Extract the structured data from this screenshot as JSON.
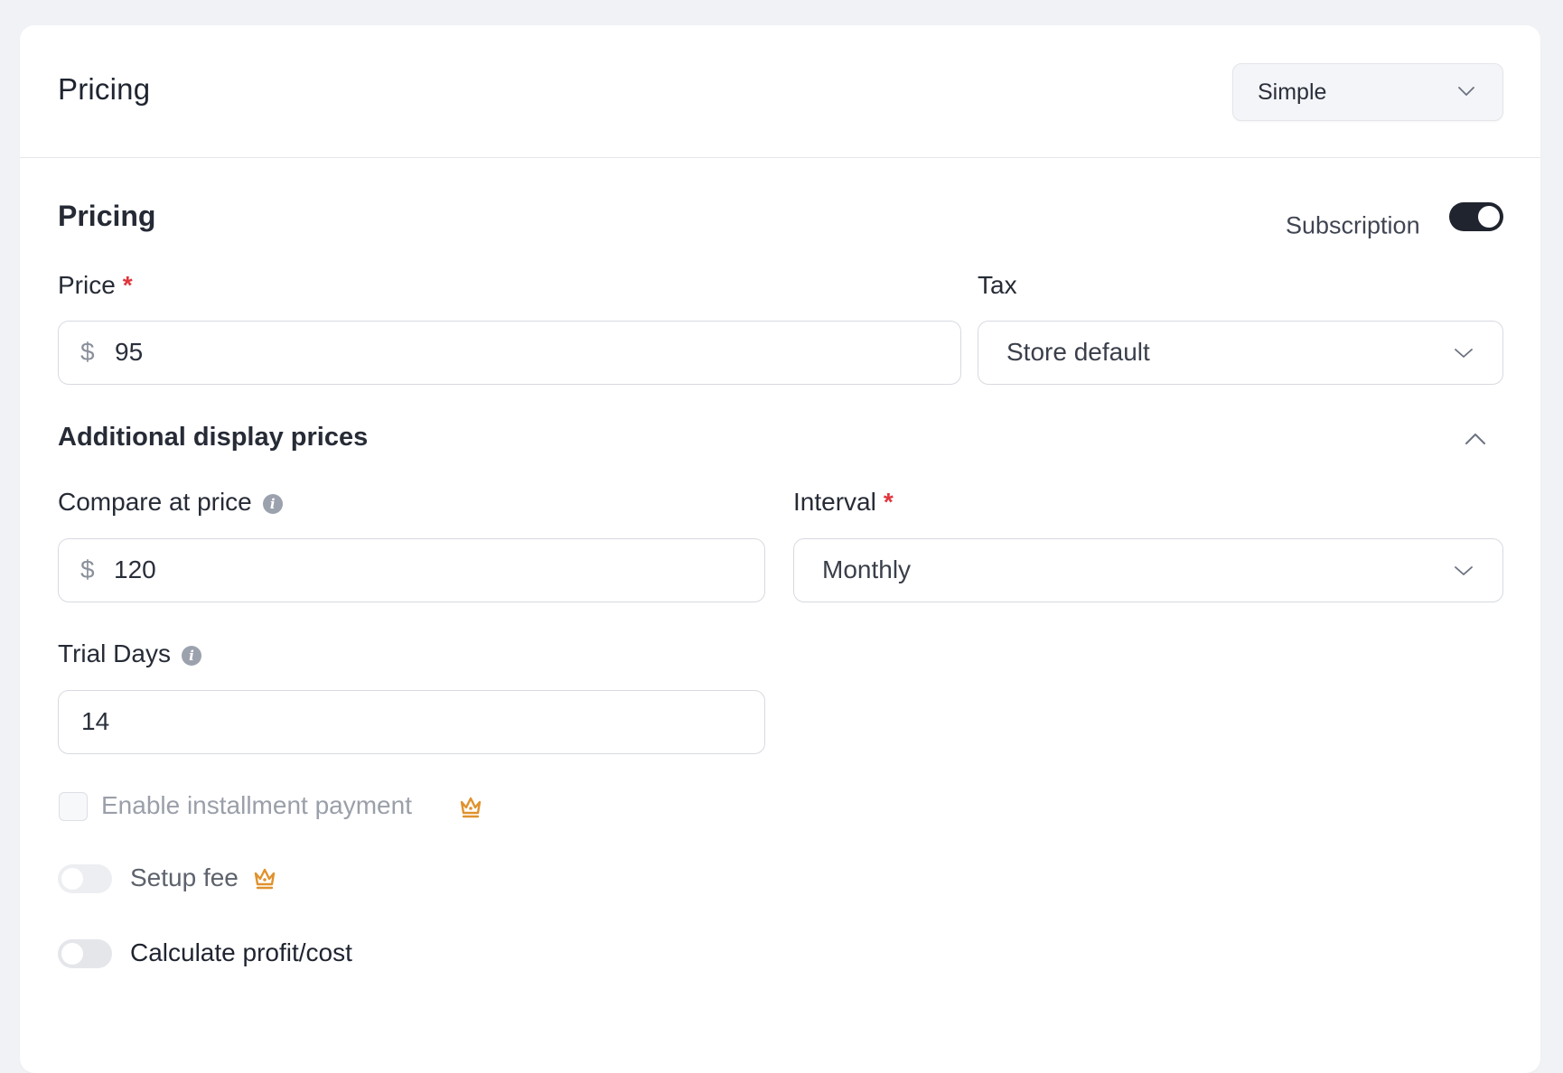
{
  "header": {
    "title": "Pricing",
    "type_select": {
      "value": "Simple"
    }
  },
  "pricing": {
    "title": "Pricing",
    "subscription": {
      "label": "Subscription",
      "enabled": true
    },
    "price": {
      "label": "Price",
      "required_mark": "*",
      "currency_symbol": "$",
      "value": "95"
    },
    "tax": {
      "label": "Tax",
      "value": "Store default"
    }
  },
  "additional_display_prices": {
    "title": "Additional display prices",
    "expanded": true,
    "compare_at_price": {
      "label": "Compare at price",
      "info_icon": "i",
      "currency_symbol": "$",
      "value": "120"
    },
    "interval": {
      "label": "Interval",
      "required_mark": "*",
      "value": "Monthly"
    },
    "trial_days": {
      "label": "Trial Days",
      "info_icon": "i",
      "value": "14"
    }
  },
  "options": {
    "installment": {
      "label": "Enable installment payment",
      "checked": false,
      "premium_icon": "crown-icon"
    },
    "setup_fee": {
      "label": "Setup fee",
      "enabled": false,
      "premium_icon": "crown-icon"
    },
    "profit_cost": {
      "label": "Calculate profit/cost",
      "enabled": false
    }
  },
  "colors": {
    "accent_dark": "#20242f",
    "required": "#e0363d",
    "premium": "#e0922d",
    "muted_text": "#9a9fa9"
  }
}
